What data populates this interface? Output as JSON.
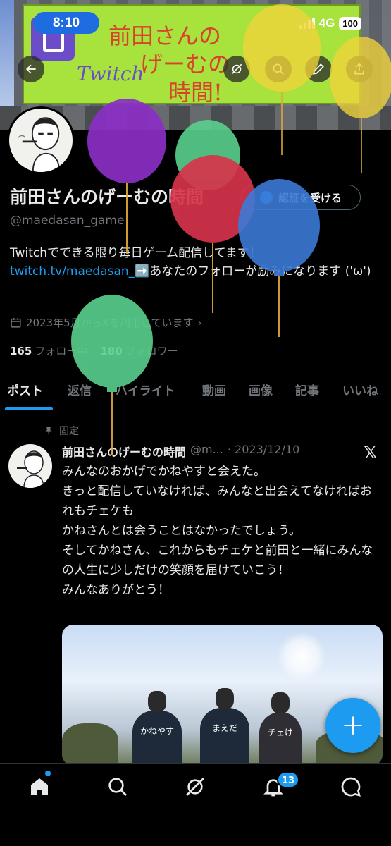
{
  "status_bar": {
    "time": "8:10",
    "network": "4G",
    "battery": "100"
  },
  "banner": {
    "sign_line1": "前田さんの",
    "sign_line2": "げーむの",
    "sign_line3": "時間!",
    "sign_brand": "Twitch"
  },
  "profile": {
    "name": "前田さんのげーむの時間",
    "handle": "@maedasan_game",
    "verify_button": "認証を受ける",
    "bio_text": "Twitchでできる限り毎日ゲーム配信してます！",
    "bio_link": "twitch.tv/maedasan_",
    "bio_after_link": "➡️あなたのフォローが励みになります ('ω')",
    "joined": "2023年5月からXを利用しています",
    "following_count": "165",
    "following_label": "フォロー中",
    "followers_count": "180",
    "followers_label": "フォロワー"
  },
  "tabs": [
    "ポスト",
    "返信",
    "ハイライト",
    "動画",
    "画像",
    "記事",
    "いいね"
  ],
  "pinned_post": {
    "pinned_label": "固定",
    "author_name": "前田さんのげーむの時間",
    "author_handle": "@m...",
    "date": "· 2023/12/10",
    "lines": [
      "みんなのおかげでかねやすと会えた。",
      "きっと配信していなければ、みんなと出会えてなければおれもチェケも",
      "かねさんとは会うことはなかったでしょう。",
      "そしてかねさん、これからもチェケと前田と一緒にみんなの人生に少しだけの笑顔を届けていこう！",
      "みんなありがとう！"
    ],
    "image_hoodies": [
      "かねやす",
      "まえだ",
      "チェけ"
    ]
  },
  "fab_label": "+",
  "bottom_nav": {
    "notifications_badge": "13"
  },
  "colors": {
    "accent": "#1d9bf0",
    "background": "#000000",
    "muted": "#71767b"
  }
}
